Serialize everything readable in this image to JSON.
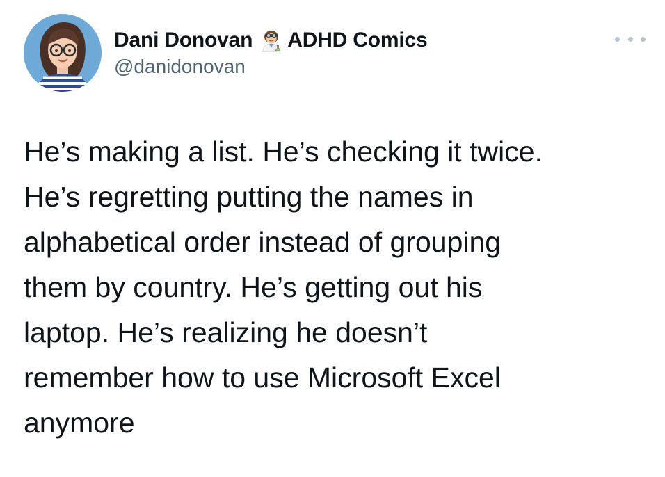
{
  "author": {
    "display_name": "Dani Donovan",
    "badge_emoji": "woman-scientist-emoji",
    "name_suffix": "ADHD Comics",
    "handle": "@danidonovan",
    "avatar": "avatar-illustration"
  },
  "more_menu": {
    "icon": "more-dots-icon"
  },
  "tweet": {
    "lines": [
      "He’s making a list. He’s checking it twice.",
      "He’s regretting putting the names in",
      "alphabetical order instead of grouping",
      "them by country. He’s getting out his",
      "laptop. He’s realizing he doesn’t",
      "remember how to use Microsoft Excel",
      "anymore"
    ]
  },
  "colors": {
    "text_primary": "#0f1419",
    "text_secondary": "#536471",
    "more_dots": "#b8c0c8"
  }
}
